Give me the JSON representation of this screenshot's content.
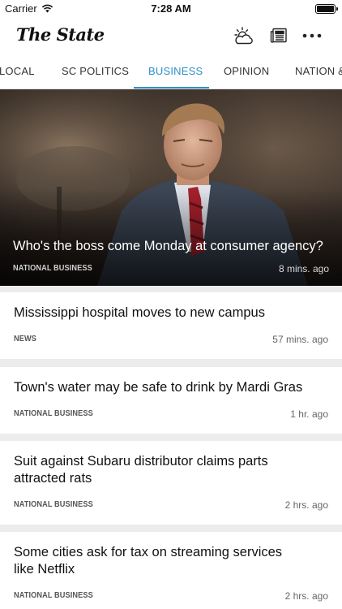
{
  "status_bar": {
    "carrier": "Carrier",
    "time": "7:28 AM"
  },
  "header": {
    "logo": "The State",
    "icons": [
      "weather-icon",
      "newspaper-icon",
      "more-icon"
    ]
  },
  "tabs": [
    {
      "label": "LOCAL"
    },
    {
      "label": "SC POLITICS"
    },
    {
      "label": "BUSINESS",
      "active": true
    },
    {
      "label": "OPINION"
    },
    {
      "label": "NATION &"
    }
  ],
  "accent_color": "#2e8fc9",
  "hero": {
    "title": "Who's the boss come Monday at consumer agency?",
    "category": "NATIONAL BUSINESS",
    "time": "8 mins. ago"
  },
  "articles": [
    {
      "title": "Mississippi hospital moves to new campus",
      "category": "NEWS",
      "time": "57 mins. ago"
    },
    {
      "title": "Town's water may be safe to drink by Mardi Gras",
      "category": "NATIONAL BUSINESS",
      "time": "1 hr. ago"
    },
    {
      "title": "Suit against Subaru distributor claims parts attracted rats",
      "category": "NATIONAL BUSINESS",
      "time": "2 hrs. ago"
    },
    {
      "title": "Some cities ask for tax on streaming services like Netflix",
      "category": "NATIONAL BUSINESS",
      "time": "2 hrs. ago"
    }
  ]
}
